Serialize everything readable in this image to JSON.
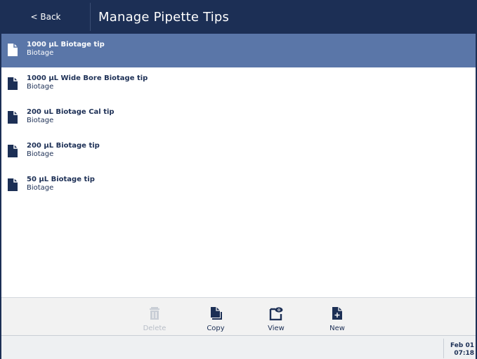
{
  "header": {
    "back_label": "< Back",
    "title": "Manage Pipette Tips"
  },
  "tips": [
    {
      "name": "1000 µL Biotage tip",
      "vendor": "Biotage",
      "selected": true
    },
    {
      "name": "1000 µL Wide Bore Biotage tip",
      "vendor": "Biotage",
      "selected": false
    },
    {
      "name": "200 uL Biotage Cal tip",
      "vendor": "Biotage",
      "selected": false
    },
    {
      "name": "200 µL Biotage tip",
      "vendor": "Biotage",
      "selected": false
    },
    {
      "name": "50 µL Biotage tip",
      "vendor": "Biotage",
      "selected": false
    }
  ],
  "toolbar": {
    "delete_label": "Delete",
    "copy_label": "Copy",
    "view_label": "View",
    "new_label": "New",
    "delete_enabled": false
  },
  "status": {
    "date": "Feb 01",
    "time": "07:18"
  },
  "colors": {
    "primary": "#1c2f55",
    "selected_row": "#5a76a8",
    "toolbar_bg": "#f2f2f2",
    "disabled": "#b8bec8"
  }
}
